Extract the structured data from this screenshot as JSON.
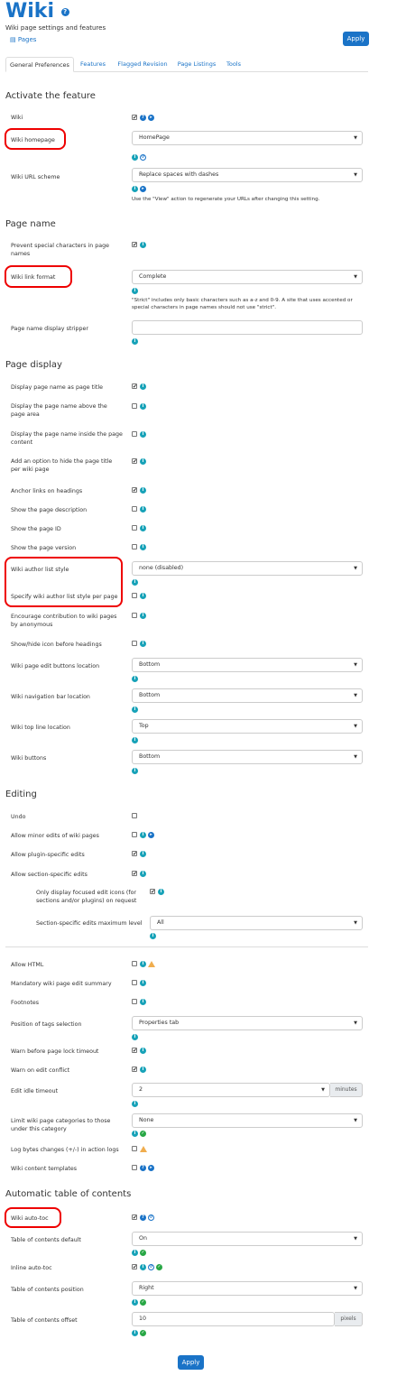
{
  "header": {
    "title": "Wiki",
    "subtitle": "Wiki page settings and features",
    "pages_link": "Pages",
    "apply_label": "Apply"
  },
  "tabs": [
    {
      "label": "General Preferences"
    },
    {
      "label": "Features"
    },
    {
      "label": "Flagged Revision"
    },
    {
      "label": "Page Listings"
    },
    {
      "label": "Tools"
    }
  ],
  "sections": {
    "activate": "Activate the feature",
    "page_name": "Page name",
    "page_display": "Page display",
    "editing": "Editing",
    "toc": "Automatic table of contents"
  },
  "activate": {
    "wiki": "Wiki",
    "wiki_homepage": "Wiki homepage",
    "wiki_homepage_value": "HomePage",
    "url_scheme": "Wiki URL scheme",
    "url_scheme_value": "Replace spaces with dashes",
    "url_scheme_help": "Use the \"View\" action to regenerate your URLs after changing this setting."
  },
  "page_name": {
    "prevent_special": "Prevent special characters in page names",
    "link_format": "Wiki link format",
    "link_format_value": "Complete",
    "link_format_help": "\"Strict\" includes only basic characters such as a-z and 0-9. A site that uses accented or special characters in page names should not use \"strict\".",
    "display_stripper": "Page name display stripper"
  },
  "page_display": {
    "as_title": "Display page name as page title",
    "above": "Display the page name above the page area",
    "inside": "Display the page name inside the page content",
    "hide_title": "Add an option to hide the page title per wiki page",
    "anchor_links": "Anchor links on headings",
    "show_description": "Show the page description",
    "show_id": "Show the page ID",
    "show_version": "Show the page version",
    "author_style": "Wiki author list style",
    "author_style_value": "none (disabled)",
    "author_per_page": "Specify wiki author list style per page",
    "encourage": "Encourage contribution to wiki pages by anonymous",
    "show_hide_icon": "Show/hide icon before headings",
    "edit_buttons_loc": "Wiki page edit buttons location",
    "edit_buttons_loc_value": "Bottom",
    "nav_bar_loc": "Wiki navigation bar location",
    "nav_bar_loc_value": "Bottom",
    "top_line_loc": "Wiki top line location",
    "top_line_loc_value": "Top",
    "wiki_buttons": "Wiki buttons",
    "wiki_buttons_value": "Bottom"
  },
  "editing": {
    "undo": "Undo",
    "minor_edits": "Allow minor edits of wiki pages",
    "plugin_edits": "Allow plugin-specific edits",
    "section_edits": "Allow section-specific edits",
    "focused_icons": "Only display focused edit icons (for sections and/or plugins) on request",
    "section_max": "Section-specific edits maximum level",
    "section_max_value": "All",
    "allow_html": "Allow HTML",
    "mandatory_summary": "Mandatory wiki page edit summary",
    "footnotes": "Footnotes",
    "tags_position": "Position of tags selection",
    "tags_position_value": "Properties tab",
    "warn_lock": "Warn before page lock timeout",
    "warn_conflict": "Warn on edit conflict",
    "idle_timeout": "Edit idle timeout",
    "idle_timeout_value": "2",
    "idle_timeout_unit": "minutes",
    "limit_categories": "Limit wiki page categories to those under this category",
    "limit_categories_value": "None",
    "log_bytes": "Log bytes changes (+/-) in action logs",
    "content_templates": "Wiki content templates"
  },
  "toc": {
    "auto_toc": "Wiki auto-toc",
    "default": "Table of contents default",
    "default_value": "On",
    "inline": "Inline auto-toc",
    "position": "Table of contents position",
    "position_value": "Right",
    "offset": "Table of contents offset",
    "offset_value": "10",
    "offset_unit": "pixels"
  },
  "footer": {
    "apply_label": "Apply"
  },
  "colors": {
    "accent": "#1a73c7",
    "info": "#17a2b8",
    "ok": "#28a745",
    "warn": "#f0ad4e",
    "highlight": "#e00000"
  }
}
